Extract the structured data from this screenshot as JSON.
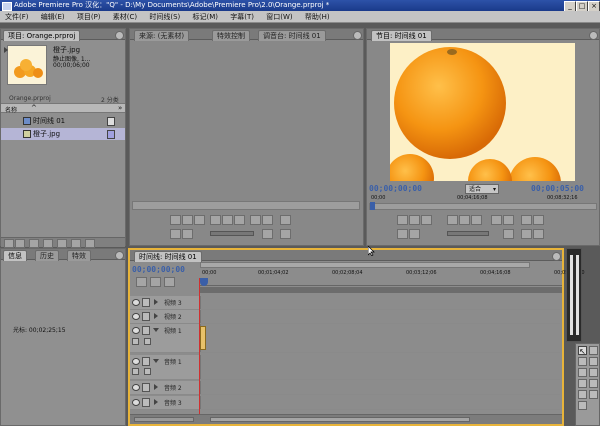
{
  "window": {
    "title": "Adobe Premiere Pro  汉化：\"Q\"  - D:\\My Documents\\Adobe\\Premiere Pro\\2.0\\Orange.prproj *",
    "minimize": "_",
    "maximize": "□",
    "close": "×"
  },
  "menu": [
    "文件(F)",
    "编辑(E)",
    "项目(P)",
    "素材(C)",
    "时间线(S)",
    "标记(M)",
    "字幕(T)",
    "窗口(W)",
    "帮助(H)"
  ],
  "project": {
    "tab": "项目: Orange.prproj",
    "clip_name": "橙子.jpg",
    "clip_info": "静止图像, 1...",
    "clip_time": "00;00;06;00",
    "project_file": "Orange.prproj",
    "item_count": "2 分类",
    "col_name": "名称",
    "items": [
      {
        "label": "时间线 01"
      },
      {
        "label": "橙子.jpg"
      }
    ]
  },
  "source": {
    "tabs": [
      "来源: (无素材)",
      "特效控制",
      "调音台: 时间线 01"
    ]
  },
  "program": {
    "tab": "节目: 时间线 01",
    "timecode_left": "00;00;00;00",
    "fit": "适合",
    "timecode_right": "00;00;05;00",
    "ruler": [
      "00;00",
      "00;04;16;08",
      "00;08;32;16"
    ]
  },
  "info": {
    "tabs": [
      "信息",
      "历史",
      "特效"
    ],
    "cursor": "光标: 00;02;25;15"
  },
  "timeline": {
    "tab": "时间线: 时间线 01",
    "timecode": "00;00;00;00",
    "ruler": [
      "00;00",
      "00;01;04;02",
      "00;02;08;04",
      "00;03;12;06",
      "00;04;16;08",
      "00;05;20;10"
    ],
    "video_tracks": [
      "视频 3",
      "视频 2",
      "视频 1"
    ],
    "audio_tracks": [
      "音频 1",
      "音频 2",
      "音频 3"
    ]
  },
  "colors": {
    "timecode": "#3a5fa8",
    "active_panel_border": "#e8b43a",
    "playhead": "#d03030"
  }
}
